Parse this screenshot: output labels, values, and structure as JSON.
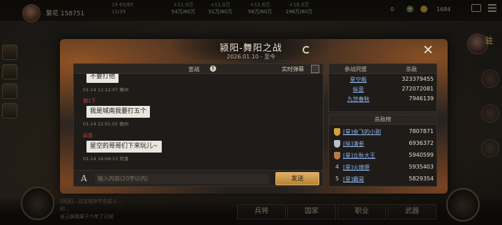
{
  "hud": {
    "player_name": "繁花 158751",
    "stats": [
      "19 65/65",
      "15/39"
    ],
    "resources": [
      {
        "plus": "+11.9万",
        "amount": "54万/60万"
      },
      {
        "plus": "+11.9万",
        "amount": "51万/60万"
      },
      {
        "plus": "+11.8万",
        "amount": "58万/60万"
      },
      {
        "plus": "+16.3万",
        "amount": "196万/60万"
      }
    ],
    "gold": "0",
    "gold_plus": "+",
    "gold2": "1684"
  },
  "right_tag": "驻",
  "modal": {
    "title": "颍阳-舞阳之战",
    "subtitle": "2026.01.10 - 至今"
  },
  "chat": {
    "title": "宣战",
    "info": "!",
    "realtime_label": "实时弹幕",
    "messages": [
      {
        "name": "",
        "text": "不要打他",
        "time": "01-14 11:12:07 豫州"
      },
      {
        "name": "御1下",
        "text": "我是城南我要打五个",
        "time": "01-14 12:01:02 扬州"
      },
      {
        "name": "纵意",
        "text": "星空的哥哥们下来玩儿~",
        "time": "01-14 14:04:13 司隶"
      }
    ],
    "input_placeholder": "输入内容(20字以内)",
    "font_icon": "A",
    "send_label": "发送"
  },
  "alliances": {
    "col_alliance": "参战同盟",
    "col_kills": "杀敌",
    "rows": [
      {
        "name": "星空殿",
        "kills": "323379455"
      },
      {
        "name": "纵意",
        "kills": "272072081"
      },
      {
        "name": "九世春秋",
        "kills": "7946139"
      }
    ]
  },
  "leaderboard": {
    "title": "杀敌榜",
    "rows": [
      {
        "rank": "1",
        "name": "[星]会飞的小刚",
        "kills": "7807871",
        "badge_color": "#d4a23a"
      },
      {
        "rank": "2",
        "name": "[纵]清参",
        "kills": "6936372",
        "badge_color": "#b8c0cc"
      },
      {
        "rank": "3",
        "name": "[星]立秋大王",
        "kills": "5940599",
        "badge_color": "#b87a45"
      },
      {
        "rank": "4",
        "name": "[星]火燎原",
        "kills": "5935403",
        "badge_color": ""
      },
      {
        "rank": "5",
        "name": "[星]霸哥",
        "kills": "5829354",
        "badge_color": ""
      }
    ]
  },
  "bottom": {
    "info_lines": [
      "[同盟]...具宝城掠夺由星斗 ...",
      "的...",
      "自己装赌属于六年了已经"
    ],
    "buttons": [
      "兵将",
      "国家",
      "职业",
      "武器"
    ]
  }
}
